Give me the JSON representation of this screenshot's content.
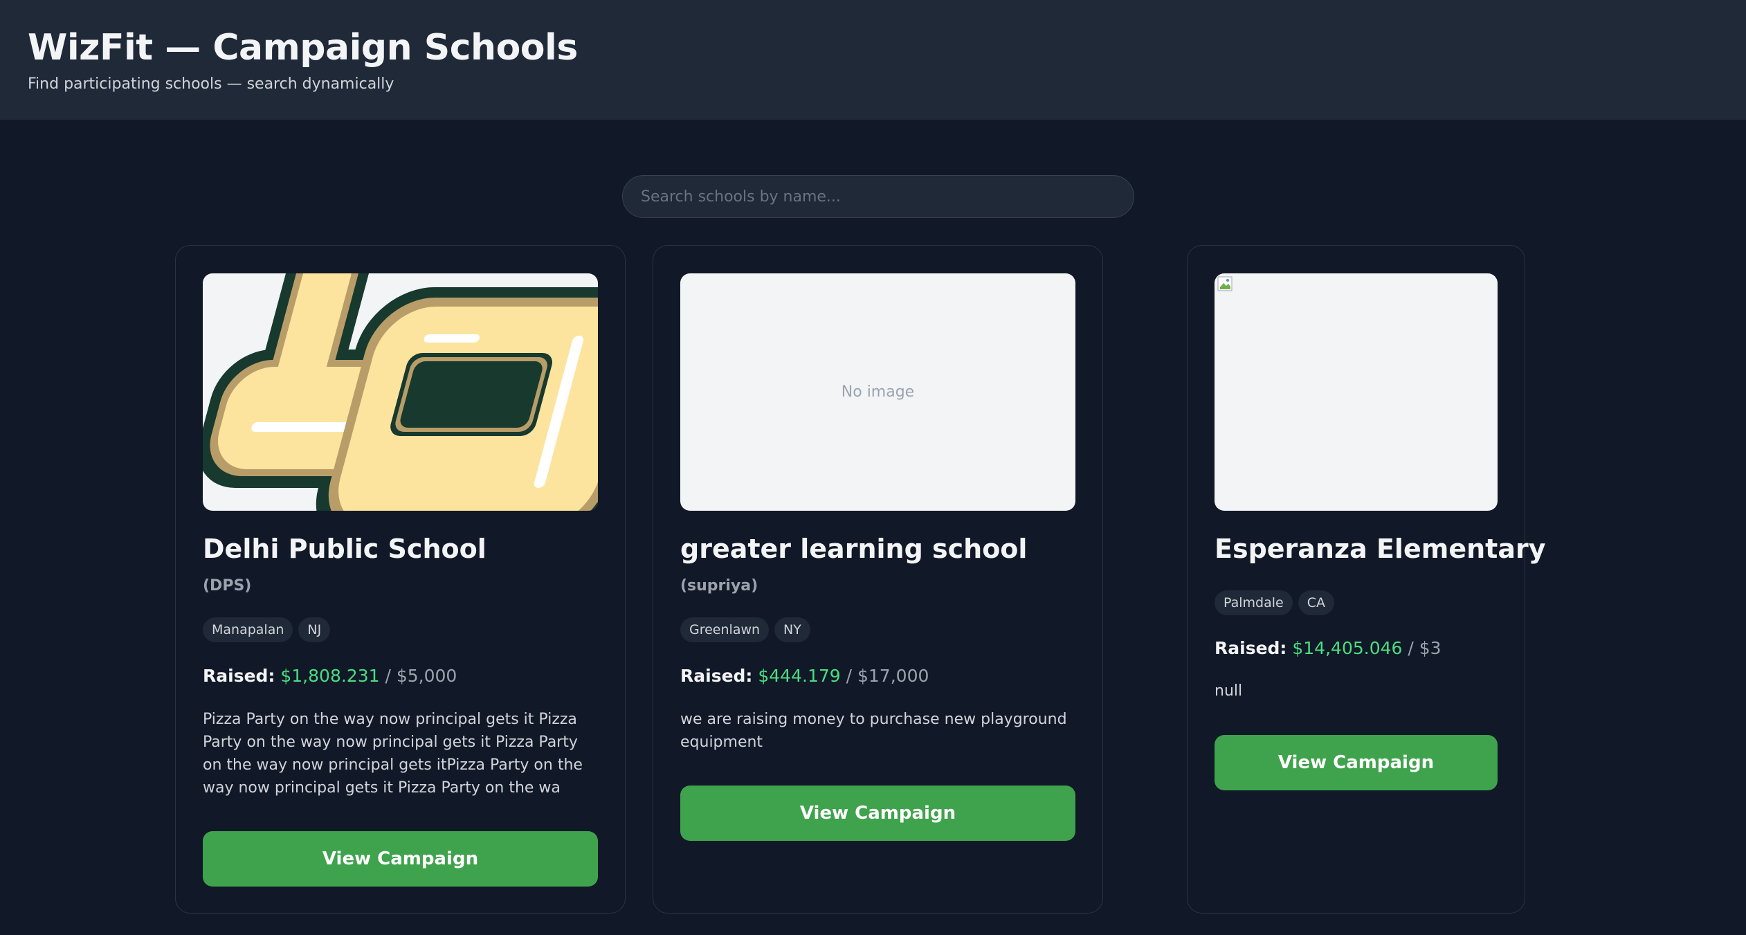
{
  "header": {
    "title": "WizFit — Campaign Schools",
    "subtitle": "Find participating schools — search dynamically"
  },
  "search": {
    "placeholder": "Search schools by name..."
  },
  "cards": [
    {
      "name": "Delhi Public School",
      "abbr": "(DPS)",
      "city": "Manapalan",
      "state": "NJ",
      "raised_label": "Raised:",
      "raised": "$1,808.231",
      "goal": "/ $5,000",
      "description": "Pizza Party on the way now principal gets it Pizza Party on the way now principal gets it Pizza Party on the way now principal gets itPizza Party on the way now principal gets it Pizza Party on the wa",
      "button": "View Campaign",
      "logo_colors": {
        "outer": "#17392e",
        "gold": "#b89d68",
        "fill": "#fde49e",
        "shine": "#ffffff"
      }
    },
    {
      "name": "greater learning school",
      "abbr": "(supriya)",
      "city": "Greenlawn",
      "state": "NY",
      "raised_label": "Raised:",
      "raised": "$444.179",
      "goal": "/ $17,000",
      "description": "we are raising money to purchase new playground equipment",
      "button": "View Campaign",
      "image_text": "No image"
    },
    {
      "name": "Esperanza Elementary",
      "city": "Palmdale",
      "state": "CA",
      "raised_label": "Raised:",
      "raised": "$14,405.046",
      "goal": "/ $3",
      "description": "null",
      "button": "View Campaign",
      "image_icon": "broken-image-icon"
    }
  ]
}
